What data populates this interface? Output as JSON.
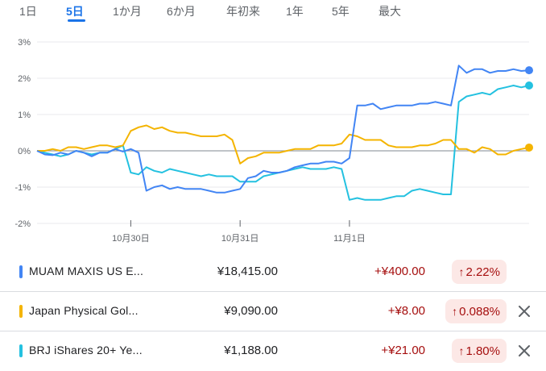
{
  "tabs": [
    {
      "label": "1日",
      "active": false
    },
    {
      "label": "5日",
      "active": true
    },
    {
      "label": "1か月",
      "active": false
    },
    {
      "label": "6か月",
      "active": false
    },
    {
      "label": "年初来",
      "active": false
    },
    {
      "label": "1年",
      "active": false
    },
    {
      "label": "5年",
      "active": false
    },
    {
      "label": "最大",
      "active": false
    }
  ],
  "colors": {
    "muam": "#4285f4",
    "gold": "#f4b400",
    "brj": "#24c1e0",
    "negative": "#a50e0e",
    "negative_bg": "#fce8e6",
    "accent": "#1a73e8"
  },
  "chart_data": {
    "type": "line",
    "x_tick_labels": [
      "10月30日",
      "10月31日",
      "11月1日"
    ],
    "y_tick_labels": [
      "3%",
      "2%",
      "1%",
      "0%",
      "-1%",
      "-2%"
    ],
    "ylim": [
      -2,
      3
    ],
    "y_unit": "%",
    "grid": true,
    "baseline": 0,
    "series": [
      {
        "name": "MUAM MAXIS US E...",
        "color": "#4285f4",
        "values": [
          0,
          -0.1,
          -0.12,
          -0.05,
          -0.1,
          0,
          -0.05,
          -0.15,
          -0.05,
          -0.05,
          0.05,
          -0.02,
          0.05,
          -0.05,
          -1.1,
          -1.0,
          -0.95,
          -1.05,
          -1.0,
          -1.05,
          -1.05,
          -1.05,
          -1.1,
          -1.15,
          -1.15,
          -1.1,
          -1.05,
          -0.75,
          -0.7,
          -0.55,
          -0.6,
          -0.6,
          -0.55,
          -0.45,
          -0.4,
          -0.35,
          -0.35,
          -0.3,
          -0.3,
          -0.35,
          -0.2,
          1.25,
          1.25,
          1.3,
          1.15,
          1.2,
          1.25,
          1.25,
          1.25,
          1.3,
          1.3,
          1.35,
          1.3,
          1.25,
          2.35,
          2.15,
          2.25,
          2.25,
          2.15,
          2.2,
          2.2,
          2.25,
          2.2,
          2.22
        ]
      },
      {
        "name": "Japan Physical Gol...",
        "color": "#f4b400",
        "values": [
          0,
          0,
          0.05,
          0,
          0.1,
          0.1,
          0.05,
          0.1,
          0.15,
          0.15,
          0.1,
          0.15,
          0.55,
          0.65,
          0.7,
          0.6,
          0.65,
          0.55,
          0.5,
          0.5,
          0.45,
          0.4,
          0.4,
          0.4,
          0.45,
          0.3,
          -0.35,
          -0.2,
          -0.15,
          -0.05,
          -0.05,
          -0.05,
          0,
          0.05,
          0.05,
          0.05,
          0.15,
          0.15,
          0.15,
          0.2,
          0.45,
          0.4,
          0.3,
          0.3,
          0.3,
          0.15,
          0.1,
          0.1,
          0.1,
          0.15,
          0.15,
          0.2,
          0.3,
          0.3,
          0.05,
          0.05,
          -0.05,
          0.1,
          0.05,
          -0.1,
          -0.1,
          0,
          0.05,
          0.09
        ]
      },
      {
        "name": "BRJ iShares 20+ Ye...",
        "color": "#24c1e0",
        "values": [
          0,
          -0.05,
          -0.1,
          -0.15,
          -0.1,
          0,
          -0.05,
          -0.1,
          -0.05,
          -0.05,
          0.05,
          0.15,
          -0.6,
          -0.65,
          -0.45,
          -0.55,
          -0.6,
          -0.5,
          -0.55,
          -0.6,
          -0.65,
          -0.7,
          -0.65,
          -0.7,
          -0.7,
          -0.7,
          -0.85,
          -0.85,
          -0.85,
          -0.7,
          -0.65,
          -0.6,
          -0.55,
          -0.5,
          -0.45,
          -0.5,
          -0.5,
          -0.5,
          -0.45,
          -0.5,
          -1.35,
          -1.3,
          -1.35,
          -1.35,
          -1.35,
          -1.3,
          -1.25,
          -1.25,
          -1.1,
          -1.05,
          -1.1,
          -1.15,
          -1.2,
          -1.2,
          1.35,
          1.5,
          1.55,
          1.6,
          1.55,
          1.7,
          1.75,
          1.8,
          1.75,
          1.8
        ]
      }
    ]
  },
  "rows": [
    {
      "name": "MUAM MAXIS US E...",
      "price": "¥18,415.00",
      "change": "+¥400.00",
      "percent": "2.22%",
      "closable": false
    },
    {
      "name": "Japan Physical Gol...",
      "price": "¥9,090.00",
      "change": "+¥8.00",
      "percent": "0.088%",
      "closable": true
    },
    {
      "name": "BRJ iShares 20+ Ye...",
      "price": "¥1,188.00",
      "change": "+¥21.00",
      "percent": "1.80%",
      "closable": true
    }
  ]
}
